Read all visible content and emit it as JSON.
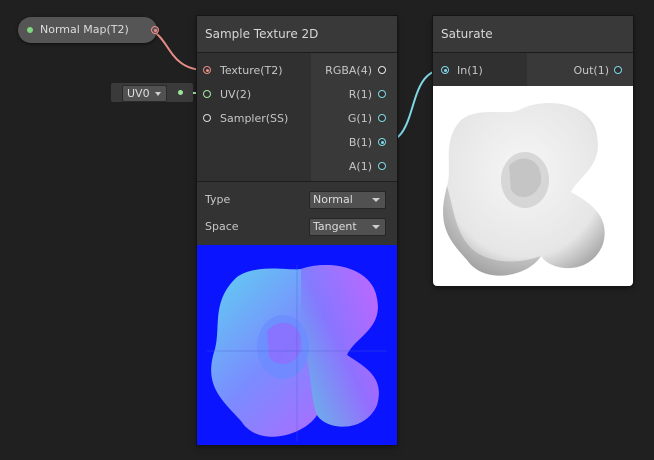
{
  "property_node": {
    "label": "Normal Map(T2)"
  },
  "uv_input": {
    "value": "UV0"
  },
  "sample_texture_node": {
    "title": "Sample Texture 2D",
    "inputs": [
      {
        "label": "Texture(T2)"
      },
      {
        "label": "UV(2)"
      },
      {
        "label": "Sampler(SS)"
      }
    ],
    "outputs": [
      {
        "label": "RGBA(4)"
      },
      {
        "label": "R(1)"
      },
      {
        "label": "G(1)"
      },
      {
        "label": "B(1)"
      },
      {
        "label": "A(1)"
      }
    ],
    "settings": [
      {
        "label": "Type",
        "value": "Normal"
      },
      {
        "label": "Space",
        "value": "Tangent"
      }
    ]
  },
  "saturate_node": {
    "title": "Saturate",
    "input": {
      "label": "In(1)"
    },
    "output": {
      "label": "Out(1)"
    }
  },
  "colors": {
    "background": "#202020",
    "texture_wire": "#e88d86",
    "uv_wire": "#a6e3a6",
    "float_wire": "#7fd7e6",
    "normal_map_blue": "#0a14ff"
  }
}
